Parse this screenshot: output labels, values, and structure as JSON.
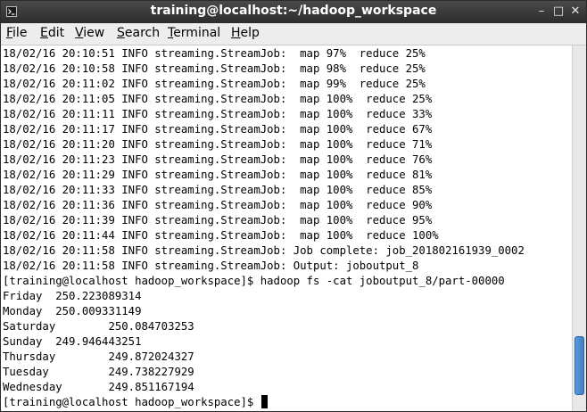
{
  "window": {
    "title": "training@localhost:~/hadoop_workspace",
    "controls": {
      "minimize": "–",
      "maximize": "□",
      "close": "✕"
    }
  },
  "menubar": {
    "items": [
      {
        "label": "File",
        "underline": "F",
        "rest": "ile"
      },
      {
        "label": "Edit",
        "underline": "E",
        "rest": "dit"
      },
      {
        "label": "View",
        "underline": "V",
        "rest": "iew"
      },
      {
        "label": "Search",
        "underline": "S",
        "rest": "earch"
      },
      {
        "label": "Terminal",
        "underline": "T",
        "rest": "erminal"
      },
      {
        "label": "Help",
        "underline": "H",
        "rest": "elp"
      }
    ]
  },
  "terminal": {
    "lines": [
      "18/02/16 20:10:51 INFO streaming.StreamJob:  map 97%  reduce 25%",
      "18/02/16 20:10:58 INFO streaming.StreamJob:  map 98%  reduce 25%",
      "18/02/16 20:11:02 INFO streaming.StreamJob:  map 99%  reduce 25%",
      "18/02/16 20:11:05 INFO streaming.StreamJob:  map 100%  reduce 25%",
      "18/02/16 20:11:11 INFO streaming.StreamJob:  map 100%  reduce 33%",
      "18/02/16 20:11:17 INFO streaming.StreamJob:  map 100%  reduce 67%",
      "18/02/16 20:11:20 INFO streaming.StreamJob:  map 100%  reduce 71%",
      "18/02/16 20:11:23 INFO streaming.StreamJob:  map 100%  reduce 76%",
      "18/02/16 20:11:29 INFO streaming.StreamJob:  map 100%  reduce 81%",
      "18/02/16 20:11:33 INFO streaming.StreamJob:  map 100%  reduce 85%",
      "18/02/16 20:11:36 INFO streaming.StreamJob:  map 100%  reduce 90%",
      "18/02/16 20:11:39 INFO streaming.StreamJob:  map 100%  reduce 95%",
      "18/02/16 20:11:44 INFO streaming.StreamJob:  map 100%  reduce 100%",
      "18/02/16 20:11:58 INFO streaming.StreamJob: Job complete: job_201802161939_0002",
      "18/02/16 20:11:58 INFO streaming.StreamJob: Output: joboutput_8",
      "[training@localhost hadoop_workspace]$ hadoop fs -cat joboutput_8/part-00000",
      "Friday  250.223089314",
      "Monday  250.009331149",
      "Saturday        250.084703253",
      "Sunday  249.946443251",
      "Thursday        249.872024327",
      "Tuesday         249.738227929",
      "Wednesday       249.851167194"
    ],
    "prompt": "[training@localhost hadoop_workspace]$ "
  },
  "scrollbar": {
    "thumb_start_fraction": 0.82,
    "thumb_end_fraction": 0.995
  }
}
